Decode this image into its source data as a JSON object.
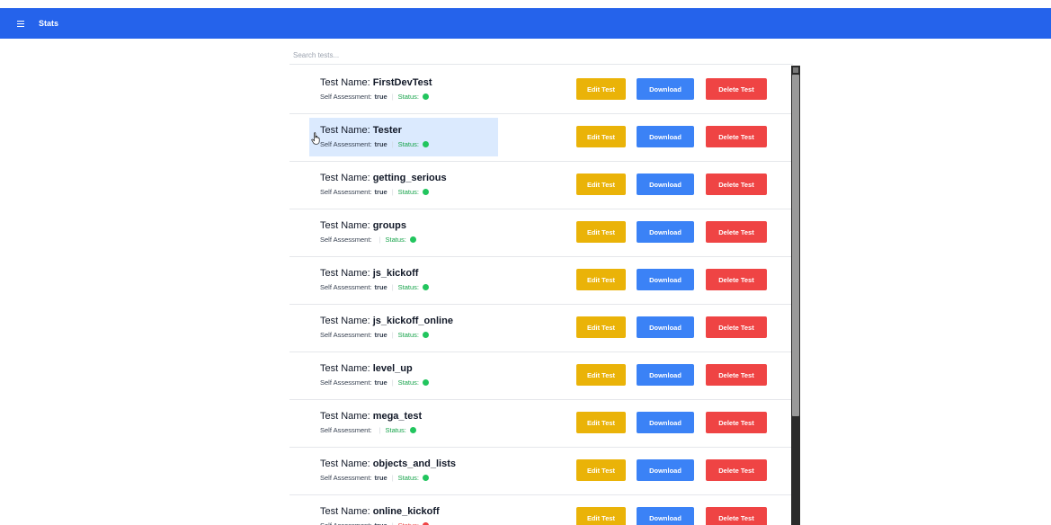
{
  "header": {
    "title": "Stats",
    "menu_icon": "hamburger-menu-icon",
    "background": "#2563eb"
  },
  "search": {
    "placeholder": "Search tests..."
  },
  "labels": {
    "name_prefix": "Test Name:",
    "self_assessment": "Self Assessment:",
    "status": "Status:",
    "sep": "|",
    "edit": "Edit Test",
    "download": "Download",
    "delete": "Delete Test"
  },
  "colors": {
    "edit": "#eab308",
    "download": "#3b82f6",
    "delete": "#ef4444",
    "status_ok": "#22c55e",
    "status_error": "#ef4444",
    "hover": "#dbeafe"
  },
  "tests": [
    {
      "name": "FirstDevTest",
      "self_assessment": "true",
      "status": "ok",
      "hovered": false
    },
    {
      "name": "Tester",
      "self_assessment": "true",
      "status": "ok",
      "hovered": true
    },
    {
      "name": "getting_serious",
      "self_assessment": "true",
      "status": "ok",
      "hovered": false
    },
    {
      "name": "groups",
      "self_assessment": "",
      "status": "ok",
      "hovered": false
    },
    {
      "name": "js_kickoff",
      "self_assessment": "true",
      "status": "ok",
      "hovered": false
    },
    {
      "name": "js_kickoff_online",
      "self_assessment": "true",
      "status": "ok",
      "hovered": false
    },
    {
      "name": "level_up",
      "self_assessment": "true",
      "status": "ok",
      "hovered": false
    },
    {
      "name": "mega_test",
      "self_assessment": "",
      "status": "ok",
      "hovered": false
    },
    {
      "name": "objects_and_lists",
      "self_assessment": "true",
      "status": "ok",
      "hovered": false
    },
    {
      "name": "online_kickoff",
      "self_assessment": "true",
      "status": "error",
      "hovered": false
    }
  ]
}
